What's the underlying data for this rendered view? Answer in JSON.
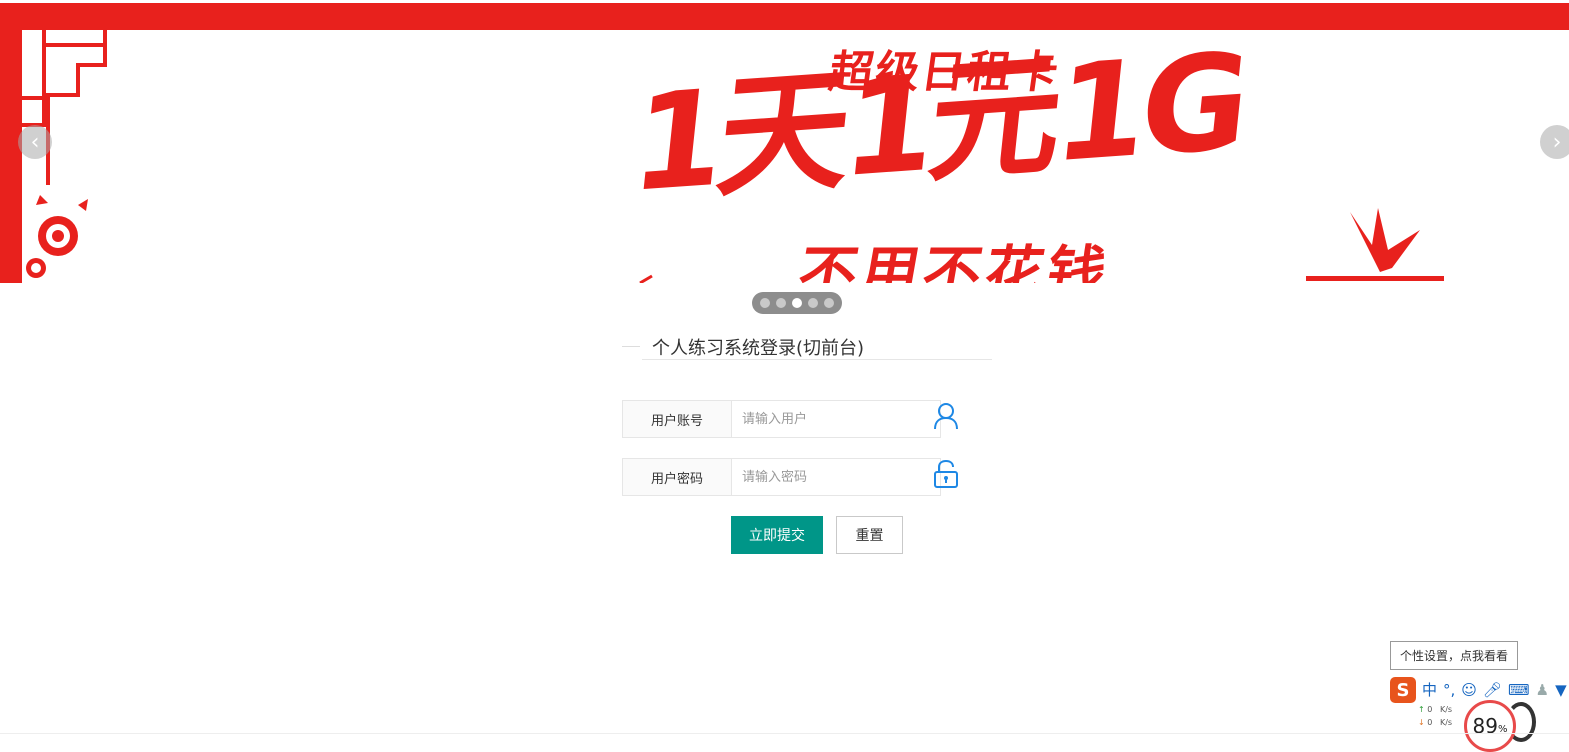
{
  "banner": {
    "line1": "超级日租卡",
    "line2": "1天1元1G",
    "line3": "不用不花钱",
    "prev_icon": "chevron-left-icon",
    "next_icon": "chevron-right-icon",
    "slides_count": 5,
    "active_slide": 3,
    "accent_color": "#e8211d"
  },
  "form": {
    "title": "个人练习系统登录(切前台)",
    "username": {
      "label": "用户账号",
      "placeholder": "请输入用户",
      "value": "",
      "icon": "user-icon"
    },
    "password": {
      "label": "用户密码",
      "placeholder": "请输入密码",
      "value": "",
      "icon": "unlock-icon"
    },
    "submit_label": "立即提交",
    "reset_label": "重置",
    "primary_color": "#009688"
  },
  "ime": {
    "tooltip": "个性设置，点我看看",
    "logo": "S",
    "mode": "中",
    "punct": "°,",
    "items": [
      "smile-icon",
      "microphone-icon",
      "keyboard-icon",
      "user-settings-icon",
      "shirt-icon"
    ]
  },
  "net": {
    "up": "0",
    "down": "0",
    "unit": "K/s",
    "percent": "89",
    "percent_sign": "%"
  }
}
